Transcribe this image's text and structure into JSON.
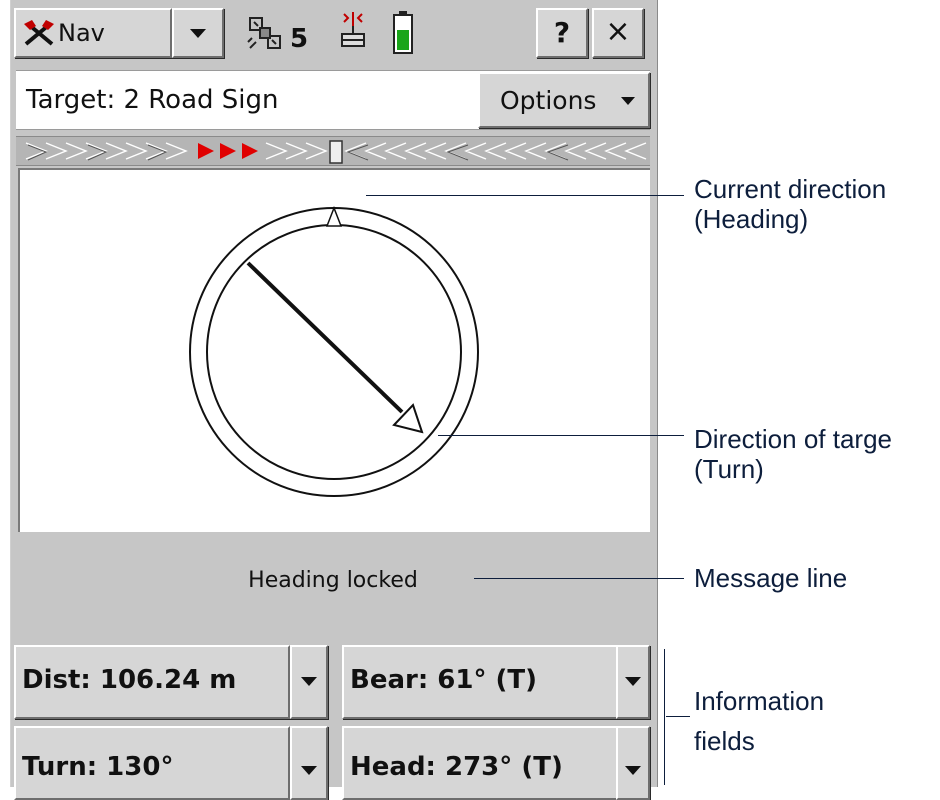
{
  "toolbar": {
    "nav_label": "Nav",
    "satellite_count": "5",
    "help_label": "?",
    "close_label": "×"
  },
  "target": {
    "text": "Target: 2 Road Sign",
    "options_label": "Options"
  },
  "message": "Heading locked",
  "fields": [
    {
      "label": "Dist: 106.24 m"
    },
    {
      "label": "Bear: 61° (T)"
    },
    {
      "label": "Turn: 130°"
    },
    {
      "label": "Head: 273° (T)"
    }
  ],
  "callouts": {
    "heading": [
      "Current direction",
      "(Heading)"
    ],
    "turn": [
      "Direction of targe",
      "(Turn)"
    ],
    "message": "Message line",
    "info": [
      "Information",
      "fields"
    ]
  },
  "colors": {
    "annotation": "#0d1e3c",
    "strip_arrows": "#e00000",
    "battery": "#1aa51a"
  },
  "icons": {
    "nav": "crossed-hammers-icon",
    "satellite": "satellite-icon",
    "radio": "radio-signal-icon",
    "battery": "battery-icon"
  }
}
